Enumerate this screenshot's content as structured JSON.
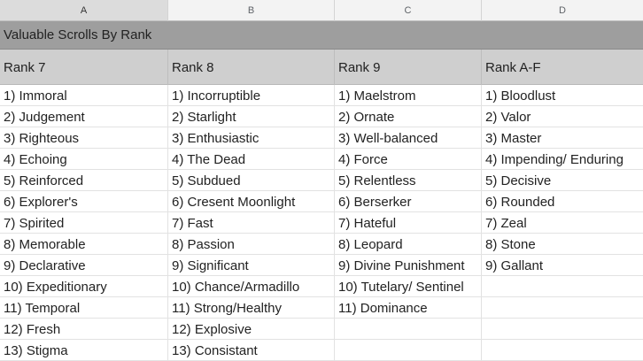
{
  "columns": [
    "A",
    "B",
    "C",
    "D"
  ],
  "title": "Valuable Scrolls By Rank",
  "ranks": [
    "Rank 7",
    "Rank 8",
    "Rank 9",
    "Rank A-F"
  ],
  "rows": [
    [
      "1) Immoral",
      "1) Incorruptible",
      "1) Maelstrom",
      "1) Bloodlust"
    ],
    [
      "2) Judgement",
      "2) Starlight",
      "2) Ornate",
      "2) Valor"
    ],
    [
      "3) Righteous",
      "3) Enthusiastic",
      "3) Well-balanced",
      "3) Master"
    ],
    [
      "4) Echoing",
      "4) The Dead",
      "4) Force",
      "4) Impending/ Enduring"
    ],
    [
      "5) Reinforced",
      "5) Subdued",
      "5) Relentless",
      "5) Decisive"
    ],
    [
      "6) Explorer's",
      "6) Cresent Moonlight",
      "6) Berserker",
      "6) Rounded"
    ],
    [
      "7) Spirited",
      "7) Fast",
      "7) Hateful",
      "7) Zeal"
    ],
    [
      "8) Memorable",
      "8) Passion",
      "8) Leopard",
      "8) Stone"
    ],
    [
      "9) Declarative",
      "9) Significant",
      "9) Divine Punishment",
      "9) Gallant"
    ],
    [
      "10) Expeditionary",
      "10) Chance/Armadillo",
      "10) Tutelary/ Sentinel",
      ""
    ],
    [
      "11) Temporal",
      "11) Strong/Healthy",
      "11) Dominance",
      ""
    ],
    [
      "12) Fresh",
      "12) Explosive",
      "",
      ""
    ],
    [
      "13) Stigma",
      "13) Consistant",
      "",
      ""
    ]
  ]
}
